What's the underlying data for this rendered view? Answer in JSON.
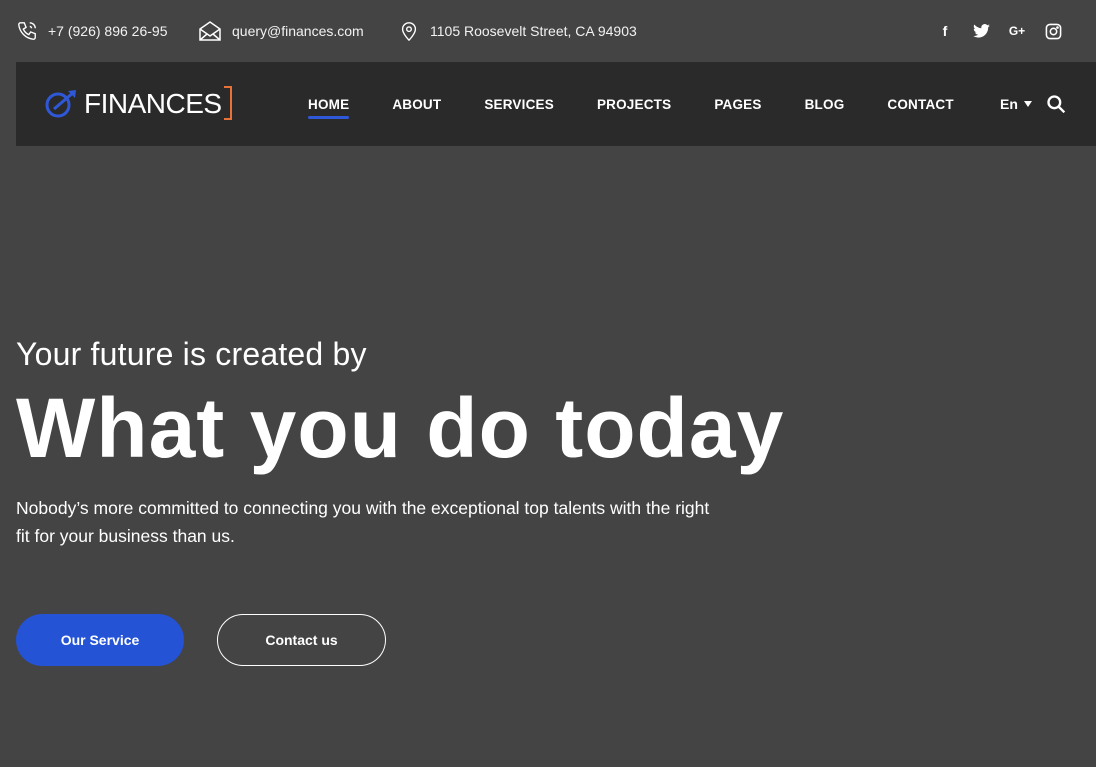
{
  "topbar": {
    "phone": "+7 (926) 896 26-95",
    "email": "query@finances.com",
    "address": "1105 Roosevelt Street, CA 94903",
    "socials": [
      {
        "icon": "facebook-icon",
        "glyph": "f"
      },
      {
        "icon": "twitter-icon",
        "glyph": ""
      },
      {
        "icon": "google-plus-icon",
        "glyph": "G+"
      },
      {
        "icon": "instagram-icon",
        "glyph": ""
      }
    ]
  },
  "nav": {
    "logo_text": "FINANCES",
    "items": [
      {
        "label": "HOME",
        "active": true
      },
      {
        "label": "ABOUT"
      },
      {
        "label": "SERVICES"
      },
      {
        "label": "PROJECTS"
      },
      {
        "label": "PAGES"
      },
      {
        "label": "BLOG"
      },
      {
        "label": "CONTACT"
      }
    ],
    "language": "En"
  },
  "hero": {
    "pretitle": "Your future is created by",
    "title": "What you do today",
    "description": "Nobody’s more committed to connecting you with the exceptional top talents with the right fit for your business than us.",
    "primary_button": "Our Service",
    "secondary_button": "Contact us"
  },
  "colors": {
    "background": "#444444",
    "navbar": "#2a2a2a",
    "accent": "#2553d6",
    "logo_bracket": "#e8733a"
  }
}
